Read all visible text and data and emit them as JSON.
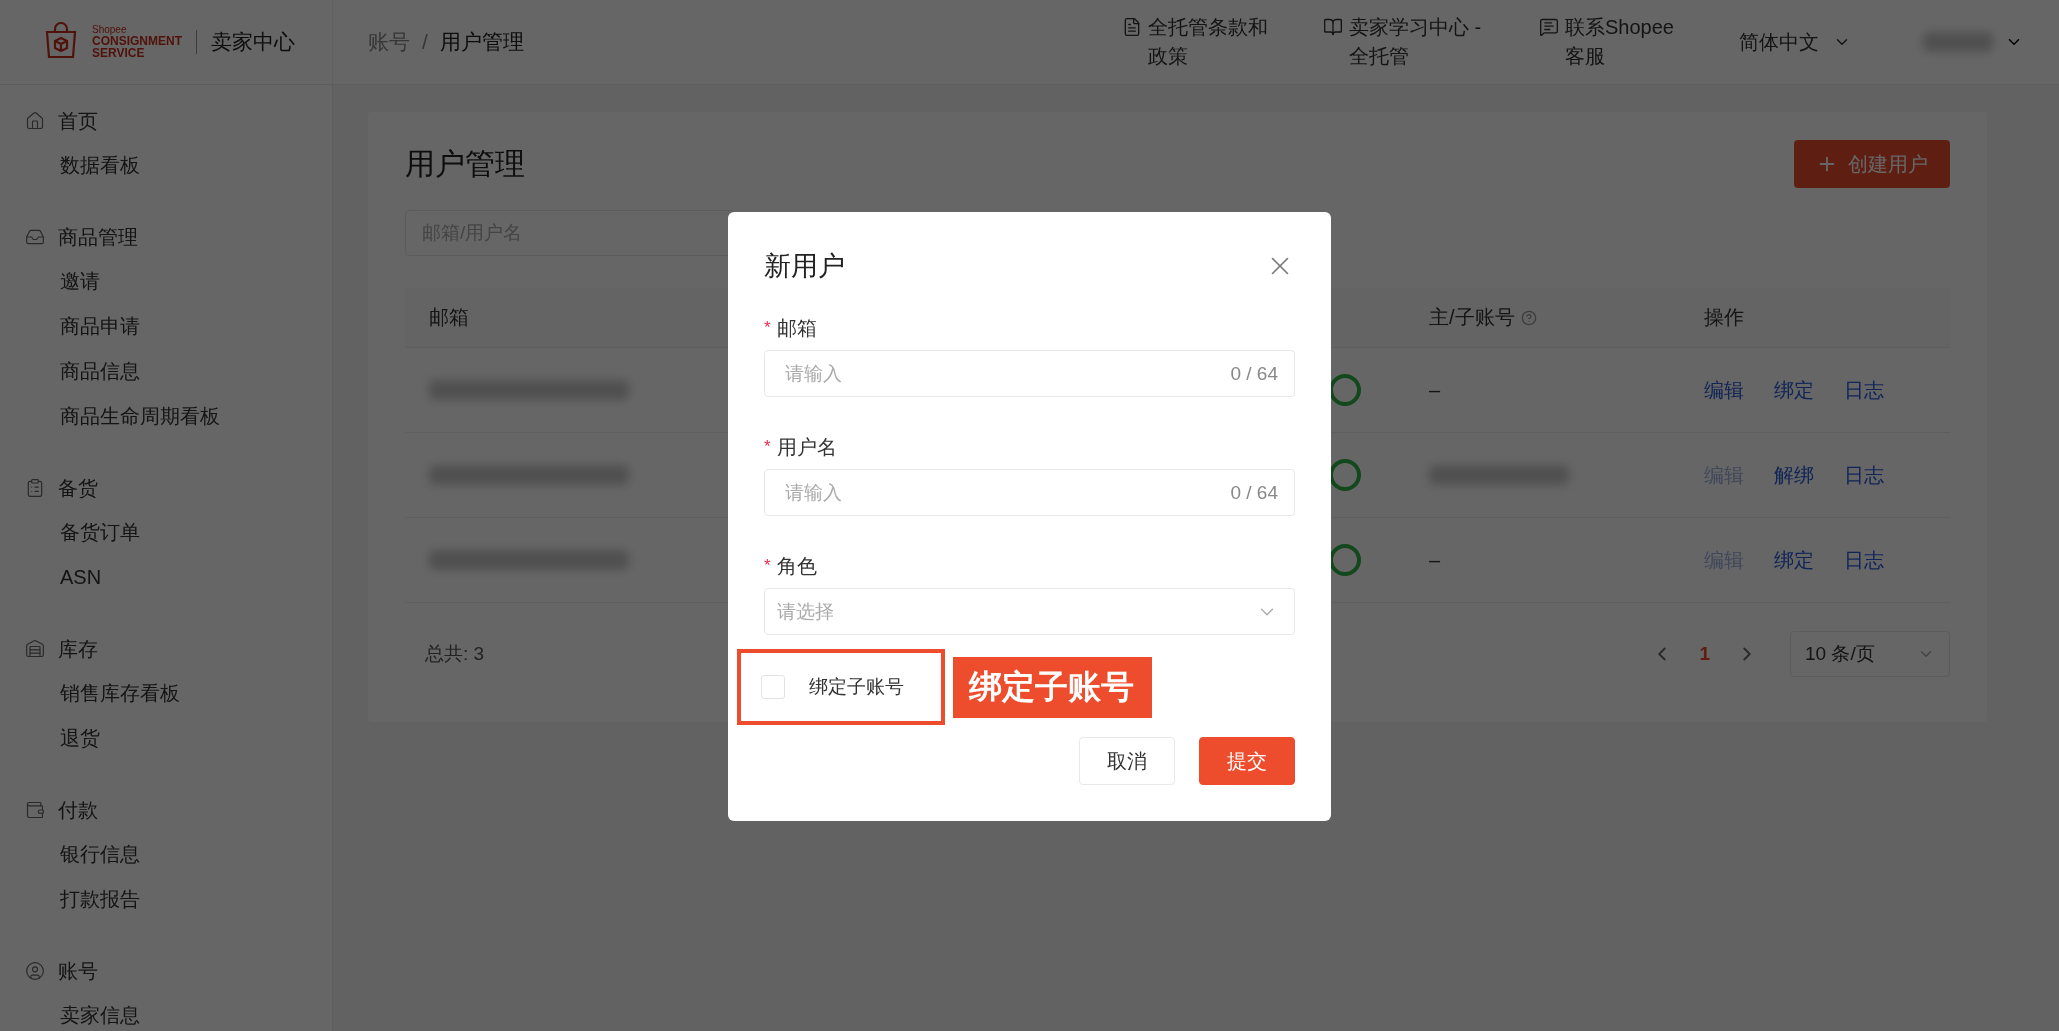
{
  "header": {
    "logo": {
      "brand": "Shopee",
      "line1": "CONSIGNMENT",
      "line2": "SERVICE"
    },
    "app_name": "卖家中心",
    "breadcrumb": {
      "items": [
        "账号",
        "用户管理"
      ],
      "separator": "/"
    },
    "links": [
      {
        "label": "全托管条款和政策"
      },
      {
        "label": "卖家学习中心 - 全托管"
      },
      {
        "label": "联系Shopee客服"
      }
    ],
    "language": "简体中文"
  },
  "sidebar": {
    "groups": [
      {
        "title": "首页",
        "items": [
          {
            "label": "数据看板"
          }
        ]
      },
      {
        "title": "商品管理",
        "items": [
          {
            "label": "邀请"
          },
          {
            "label": "商品申请"
          },
          {
            "label": "商品信息"
          },
          {
            "label": "商品生命周期看板"
          }
        ]
      },
      {
        "title": "备货",
        "items": [
          {
            "label": "备货订单"
          },
          {
            "label": "ASN"
          }
        ]
      },
      {
        "title": "库存",
        "items": [
          {
            "label": "销售库存看板"
          },
          {
            "label": "退货"
          }
        ]
      },
      {
        "title": "付款",
        "items": [
          {
            "label": "银行信息"
          },
          {
            "label": "打款报告"
          }
        ]
      },
      {
        "title": "账号",
        "items": [
          {
            "label": "卖家信息"
          }
        ]
      }
    ]
  },
  "page": {
    "title": "用户管理",
    "create_button": "创建用户",
    "search_placeholder": "邮箱/用户名",
    "table": {
      "columns": [
        {
          "label": "邮箱",
          "help": false
        },
        {
          "label": "主/子账号",
          "help": true
        },
        {
          "label": "操作",
          "help": false
        }
      ],
      "rows": [
        {
          "sub_account": {
            "kind": "text",
            "text": "–"
          },
          "actions": [
            {
              "label": "编辑",
              "disabled": false
            },
            {
              "label": "绑定",
              "disabled": false
            },
            {
              "label": "日志",
              "disabled": false
            }
          ]
        },
        {
          "sub_account": {
            "kind": "blurred"
          },
          "actions": [
            {
              "label": "编辑",
              "disabled": true
            },
            {
              "label": "解绑",
              "disabled": false
            },
            {
              "label": "日志",
              "disabled": false
            }
          ]
        },
        {
          "sub_account": {
            "kind": "text",
            "text": "–"
          },
          "actions": [
            {
              "label": "编辑",
              "disabled": true
            },
            {
              "label": "绑定",
              "disabled": false
            },
            {
              "label": "日志",
              "disabled": false
            }
          ]
        }
      ]
    },
    "total": "总共: 3",
    "pagination": {
      "pages": [
        {
          "label": "1",
          "selected": true
        }
      ],
      "page_size": "10 条/页"
    }
  },
  "dialog": {
    "title": "新用户",
    "fields": [
      {
        "kind": "text",
        "label": "邮箱",
        "required_mark": "*",
        "placeholder": "请输入",
        "counter": "0 / 64"
      },
      {
        "kind": "text",
        "label": "用户名",
        "required_mark": "*",
        "placeholder": "请输入",
        "counter": "0 / 64"
      },
      {
        "kind": "select",
        "label": "角色",
        "required_mark": "*",
        "placeholder": "请选择"
      }
    ],
    "checkbox": {
      "label": "绑定子账号",
      "checked": false
    },
    "annotation": "绑定子账号",
    "buttons": [
      {
        "kind": "secondary",
        "label": "取消"
      },
      {
        "kind": "primary",
        "label": "提交"
      }
    ]
  }
}
